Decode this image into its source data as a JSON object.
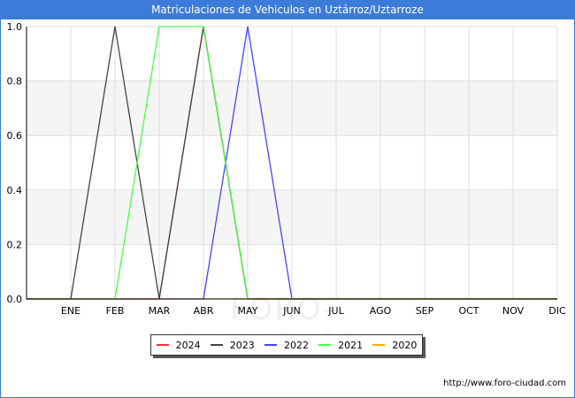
{
  "title": "Matriculaciones de Vehiculos en Uztárroz/Uztarroze",
  "source": "http://www.foro-ciudad.com",
  "watermark": "FORO-CIUDAD.COM",
  "chart_data": {
    "type": "line",
    "categories": [
      "",
      "ENE",
      "FEB",
      "MAR",
      "ABR",
      "MAY",
      "JUN",
      "JUL",
      "AGO",
      "SEP",
      "OCT",
      "NOV",
      "DIC"
    ],
    "ylim": [
      0,
      1
    ],
    "yticks": [
      "0.0",
      "0.2",
      "0.4",
      "0.6",
      "0.8",
      "1.0"
    ],
    "grid": true,
    "legend_position": "bottom",
    "series": [
      {
        "name": "2024",
        "color": "#ff3333",
        "values": [
          0,
          0,
          0,
          0,
          1,
          0,
          0,
          0,
          0,
          0,
          0,
          0,
          0
        ]
      },
      {
        "name": "2023",
        "color": "#444444",
        "values": [
          0,
          0,
          1,
          0,
          1,
          0,
          0,
          0,
          0,
          0,
          0,
          0,
          0
        ]
      },
      {
        "name": "2022",
        "color": "#4444ff",
        "values": [
          0,
          0,
          0,
          0,
          0,
          1,
          0,
          0,
          0,
          0,
          0,
          0,
          0
        ]
      },
      {
        "name": "2021",
        "color": "#44ff44",
        "values": [
          0,
          0,
          0,
          1,
          1,
          0,
          0,
          0,
          0,
          0,
          0,
          0,
          0
        ]
      },
      {
        "name": "2020",
        "color": "#ffaa00",
        "values": [
          0,
          0,
          0,
          0,
          0,
          0,
          0,
          0,
          0,
          0,
          0,
          0,
          0
        ]
      }
    ]
  }
}
